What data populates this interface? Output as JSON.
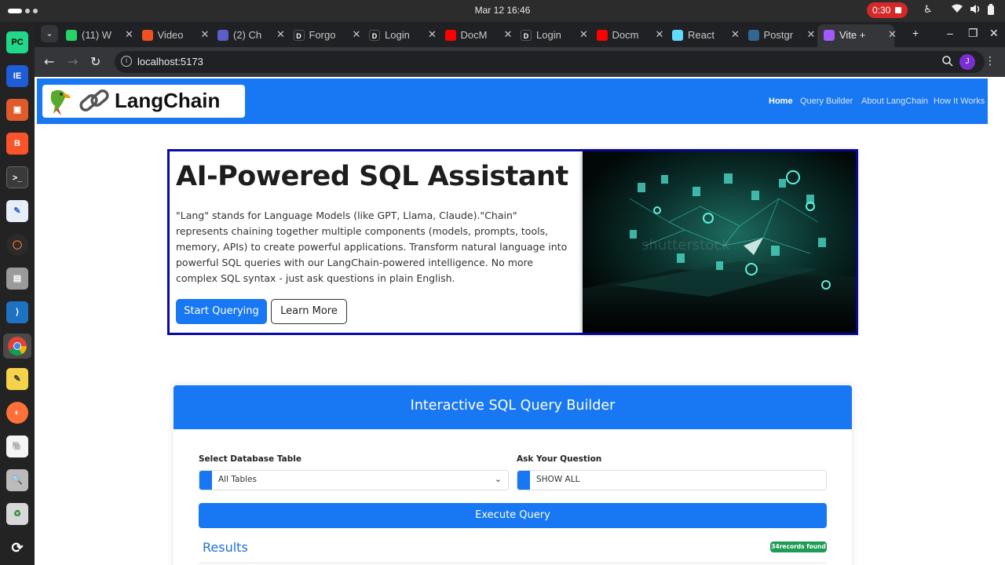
{
  "os": {
    "clock": "Mar 12  16:46",
    "recording_time": "0:30"
  },
  "browser": {
    "tabs": [
      {
        "title": "(11) W",
        "icon": "whatsapp-icon",
        "color": "#25d366"
      },
      {
        "title": "Video",
        "icon": "microsoft-icon",
        "color": "#f25022"
      },
      {
        "title": "(2) Ch",
        "icon": "teams-icon",
        "color": "#5b5fc7"
      },
      {
        "title": "Forgo",
        "icon": "d-icon",
        "color": "#202124"
      },
      {
        "title": "Login",
        "icon": "d-icon",
        "color": "#202124"
      },
      {
        "title": "DocM",
        "icon": "youtube-icon",
        "color": "#ff0000"
      },
      {
        "title": "Login",
        "icon": "d-icon",
        "color": "#202124"
      },
      {
        "title": "Docm",
        "icon": "youtube-icon",
        "color": "#ff0000"
      },
      {
        "title": "React",
        "icon": "react-icon",
        "color": "#61dafb"
      },
      {
        "title": "Postgr",
        "icon": "postgres-icon",
        "color": "#336791"
      },
      {
        "title": "Vite +",
        "icon": "vite-icon",
        "color": "#a259ff"
      }
    ],
    "url": "localhost:5173",
    "profile_initial": "J"
  },
  "site": {
    "logo_text": "LangChain",
    "nav": [
      "Home",
      "Query Builder",
      "About LangChain",
      "How It Works"
    ],
    "accent": "#1877f2"
  },
  "hero": {
    "title": "AI-Powered SQL Assistant",
    "description": "\"Lang\" stands for Language Models (like GPT, Llama, Claude).\"Chain\" represents chaining together multiple components (models, prompts, tools, memory, APIs) to create powerful applications. Transform natural language into powerful SQL queries with our LangChain-powered intelligence. No more complex SQL syntax - just ask questions in plain English.",
    "primary_button": "Start Querying",
    "secondary_button": "Learn More"
  },
  "builder": {
    "title": "Interactive SQL Query Builder",
    "table_label": "Select Database Table",
    "table_value": "All Tables",
    "question_label": "Ask Your Question",
    "question_value": "SHOW ALL",
    "execute_label": "Execute Query",
    "results_label": "Results",
    "records_badge": "34records found"
  }
}
